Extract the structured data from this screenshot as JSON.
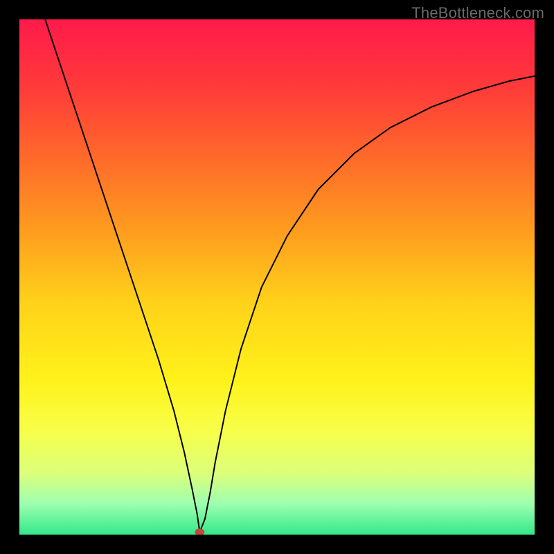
{
  "watermark": "TheBottleneck.com",
  "chart_data": {
    "type": "line",
    "title": "",
    "xlabel": "",
    "ylabel": "",
    "xlim": [
      0,
      100
    ],
    "ylim": [
      0,
      100
    ],
    "grid": false,
    "background_gradient": {
      "stops": [
        {
          "pos": 0.0,
          "color": "#ff1a4b"
        },
        {
          "pos": 0.13,
          "color": "#ff3a3a"
        },
        {
          "pos": 0.27,
          "color": "#ff6a2a"
        },
        {
          "pos": 0.42,
          "color": "#ffa01e"
        },
        {
          "pos": 0.55,
          "color": "#ffd21a"
        },
        {
          "pos": 0.7,
          "color": "#fff21a"
        },
        {
          "pos": 0.8,
          "color": "#f7ff4a"
        },
        {
          "pos": 0.88,
          "color": "#dcff7a"
        },
        {
          "pos": 0.94,
          "color": "#9effb0"
        },
        {
          "pos": 1.0,
          "color": "#33e889"
        }
      ]
    },
    "series": [
      {
        "name": "curve",
        "stroke": "#000000",
        "stroke_width": 2,
        "x": [
          5,
          8,
          12,
          16,
          20,
          24,
          27,
          30,
          32,
          33.5,
          34.5,
          35,
          36,
          37,
          38,
          40,
          43,
          47,
          52,
          58,
          65,
          72,
          80,
          88,
          95,
          100
        ],
        "y": [
          100,
          91,
          79,
          67,
          55,
          43,
          34,
          24,
          16,
          9,
          4,
          0.5,
          3,
          8,
          14,
          24,
          36,
          48,
          58,
          67,
          74,
          79,
          83,
          86,
          88,
          89
        ]
      }
    ],
    "marker": {
      "x": 35,
      "y": 0.5,
      "color": "#c0483f",
      "rx": 7,
      "ry": 5
    }
  }
}
